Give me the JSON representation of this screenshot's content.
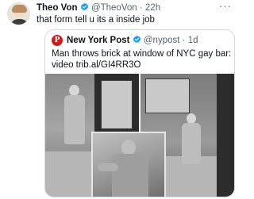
{
  "tweet": {
    "author_name": "Theo Von",
    "verified": true,
    "handle": "@TheoVon",
    "separator": "·",
    "time": "22h",
    "more_label": "···",
    "text": "that form tell u its a inside job"
  },
  "quoted_tweet": {
    "logo_letter": "P",
    "author_name": "New York Post",
    "verified": true,
    "handle": "@nypost",
    "separator": "·",
    "time": "1d",
    "text_line1": "Man throws brick at window of NYC gay bar:",
    "text_line2": "video trib.al/GI4RR3O"
  },
  "colors": {
    "text_primary": "#0f1419",
    "text_secondary": "#536471",
    "verified_blue": "#1d9bf0",
    "nypost_red": "#d31a1a",
    "border": "#cfd9de"
  },
  "icons": {
    "verified": "verified-badge-icon",
    "more": "more-icon"
  }
}
